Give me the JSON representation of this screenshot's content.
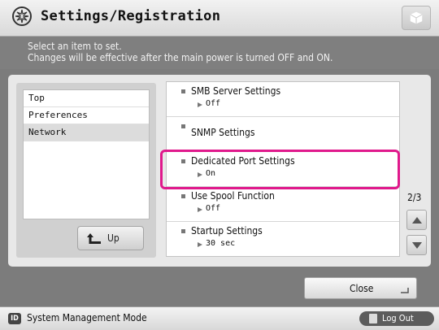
{
  "window": {
    "title": "Settings/Registration",
    "title_icon": "settings-gear-icon",
    "top_right_button_icon": "cube-icon"
  },
  "message": {
    "line1": "Select an item to set.",
    "line2": "Changes will be effective after the main power is turned OFF and ON."
  },
  "sidebar": {
    "items": [
      {
        "label": "Top"
      },
      {
        "label": "Preferences"
      },
      {
        "label": "Network"
      }
    ],
    "selected": "Network",
    "up_label": "Up"
  },
  "list": {
    "items": [
      {
        "name": "SMB Server Settings",
        "value": "Off"
      },
      {
        "name": "SNMP Settings",
        "value": ""
      },
      {
        "name": "Dedicated Port Settings",
        "value": "On"
      },
      {
        "name": "Use Spool Function",
        "value": "Off"
      },
      {
        "name": "Startup Settings",
        "value": "30 sec"
      }
    ],
    "highlighted": "Dedicated Port Settings",
    "highlight_color": "#e0198c"
  },
  "pager": {
    "page": "2/3"
  },
  "footer": {
    "close_label": "Close"
  },
  "status": {
    "id_badge": "ID",
    "mode": "System Management Mode",
    "logout_label": "Log Out"
  }
}
